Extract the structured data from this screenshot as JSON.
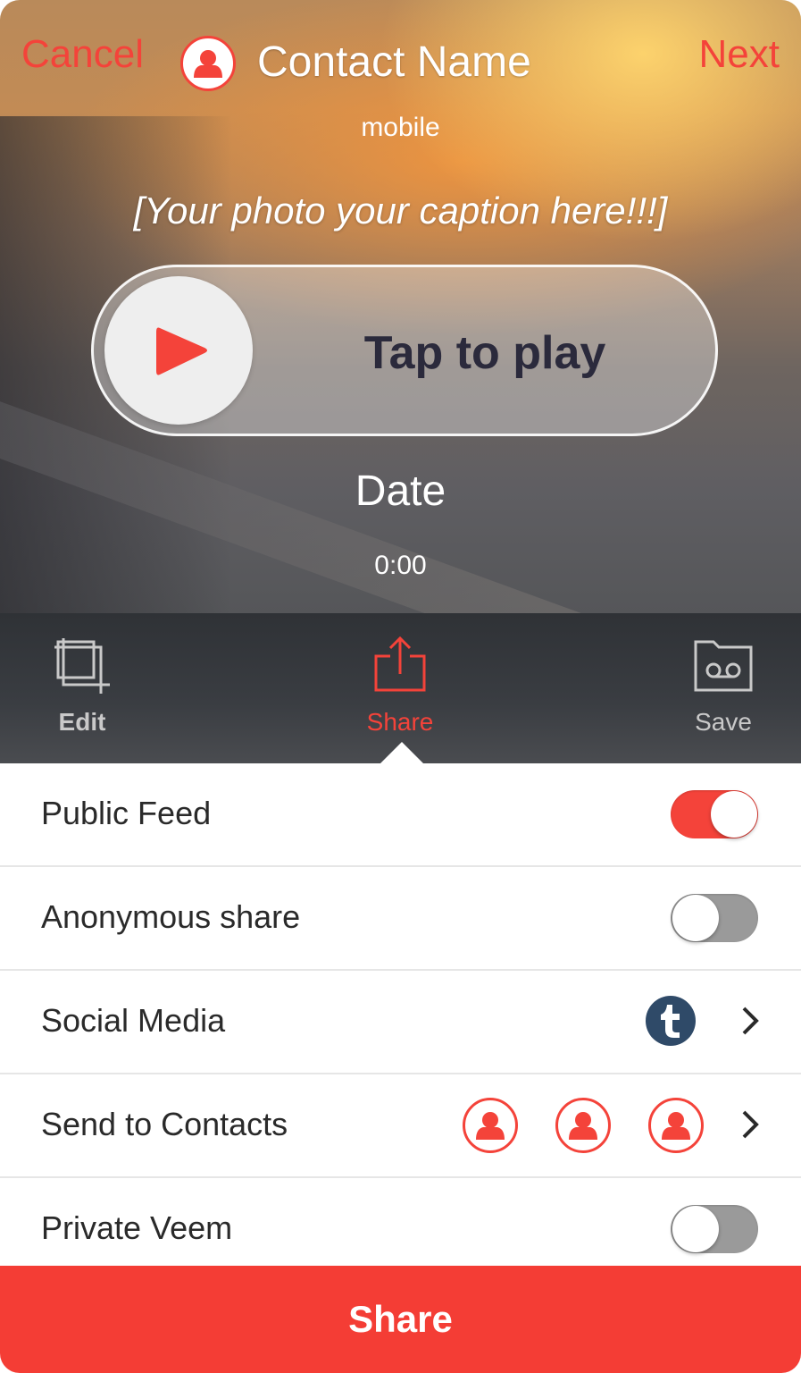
{
  "header": {
    "cancel_label": "Cancel",
    "title": "Contact Name",
    "subtitle": "mobile",
    "next_label": "Next"
  },
  "photo": {
    "caption": "[Your photo your caption here!!!]",
    "player_label": "Tap to play",
    "date": "Date",
    "duration": "0:00"
  },
  "toolbar": {
    "edit_label": "Edit",
    "share_label": "Share",
    "save_label": "Save",
    "active": "share"
  },
  "options": {
    "public_feed": {
      "label": "Public Feed",
      "on": true
    },
    "anonymous_share": {
      "label": "Anonymous share",
      "on": false
    },
    "social_media": {
      "label": "Social Media",
      "icon": "tumblr-icon"
    },
    "send_to_contacts": {
      "label": "Send to Contacts",
      "contact_count": 3
    },
    "private_veem": {
      "label": "Private Veem",
      "on": false
    }
  },
  "share_button_label": "Share",
  "colors": {
    "accent": "#f4433a",
    "toolbar": "#34373b",
    "tumblr": "#2f4a68",
    "toggle_off": "#9a9a9a"
  }
}
